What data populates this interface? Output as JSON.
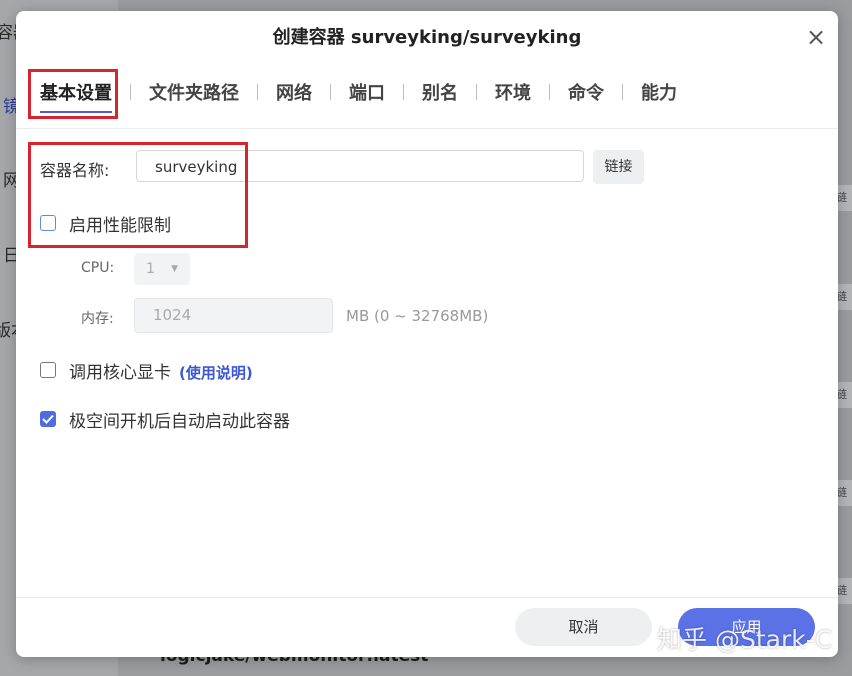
{
  "background": {
    "sidebar_items": [
      "容器",
      "镜",
      "网",
      "日",
      "版本"
    ],
    "right_tag_label": "链接",
    "bottom_text": "logicjake/webmonitor:latest"
  },
  "dialog": {
    "title": "创建容器 surveyking/surveyking",
    "close_icon": "×",
    "tabs": [
      {
        "label": "基本设置",
        "active": true
      },
      {
        "label": "文件夹路径"
      },
      {
        "label": "网络"
      },
      {
        "label": "端口"
      },
      {
        "label": "别名"
      },
      {
        "label": "环境"
      },
      {
        "label": "命令"
      },
      {
        "label": "能力"
      }
    ],
    "container_name": {
      "label": "容器名称:",
      "value": "surveyking",
      "link_button": "链接"
    },
    "perf_limit": {
      "label": "启用性能限制",
      "checked": false
    },
    "cpu": {
      "label": "CPU:",
      "value": "1"
    },
    "memory": {
      "label": "内存:",
      "value": "1024",
      "unit": "MB (0 ~ 32768MB)"
    },
    "gpu": {
      "label": "调用核心显卡",
      "help_link": "(使用说明)",
      "checked": false
    },
    "autostart": {
      "label": "极空间开机后自动启动此容器",
      "checked": true
    },
    "buttons": {
      "cancel": "取消",
      "apply": "应用"
    }
  },
  "watermark": "知乎 @Stark-C",
  "colors": {
    "accent": "#5a72e6",
    "highlight": "#d8242e"
  }
}
